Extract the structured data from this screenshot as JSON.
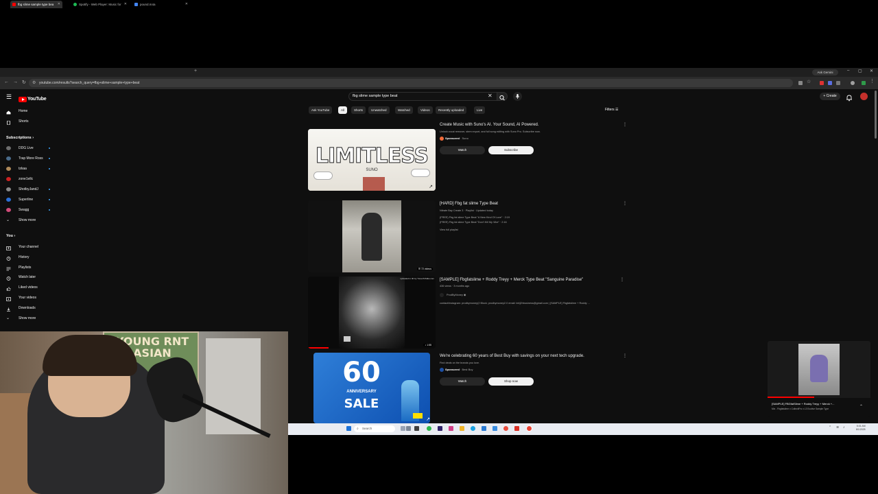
{
  "browser": {
    "tabs": [
      {
        "label": "fbg slime sample type bea",
        "color": "#ff0000"
      },
      {
        "label": "Spotify - Web Player: Music for",
        "color": "#1db954"
      },
      {
        "label": "pound.m4a",
        "color": "#4285f4"
      }
    ],
    "new_tab": "+",
    "gemini_label": "Ask Gemini",
    "url": "youtube.com/results?search_query=fbg+slime+sample+type+beat"
  },
  "youtube": {
    "logo_text": "YouTube",
    "search_value": "fbg slime sample type beat",
    "create_label": "Create",
    "filters_label": "Filters"
  },
  "sidebar": {
    "top": [
      {
        "label": "Home",
        "icon": "home-icon"
      },
      {
        "label": "Shorts",
        "icon": "shorts-icon"
      }
    ],
    "subscriptions_heading": "Subscriptions",
    "subscriptions": [
      {
        "label": "DDG Live",
        "color": "#6d6d6d"
      },
      {
        "label": "Trap More Ross",
        "color": "#4a6b8a"
      },
      {
        "label": "tzkaa",
        "color": "#b08a5a"
      },
      {
        "label": "zone1ellc",
        "color": "#cc2222"
      },
      {
        "label": "ShotbyJandJ",
        "color": "#888888"
      },
      {
        "label": "Superline",
        "color": "#2b6fd6"
      },
      {
        "label": "Swagg",
        "color": "#d14b7a"
      }
    ],
    "show_more_1": "Show more",
    "you_heading": "You",
    "you": [
      {
        "label": "Your channel",
        "icon": "channel-icon"
      },
      {
        "label": "History",
        "icon": "history-icon"
      },
      {
        "label": "Playlists",
        "icon": "playlists-icon"
      },
      {
        "label": "Watch later",
        "icon": "watch-later-icon"
      },
      {
        "label": "Liked videos",
        "icon": "liked-icon"
      },
      {
        "label": "Your videos",
        "icon": "your-videos-icon"
      },
      {
        "label": "Downloads",
        "icon": "downloads-icon"
      }
    ],
    "show_more_2": "Show more"
  },
  "chips": [
    "Ask YouTube",
    "All",
    "Shorts",
    "Unwatched",
    "Watched",
    "Videos",
    "Recently uploaded",
    "Live"
  ],
  "results": {
    "ad1": {
      "title": "Create Music with Suno's AI. Your Sound, AI Powered.",
      "desc": "Unlock vocal remover, stem export, and full song editing with Suno Pro. Subscribe now.",
      "sponsored": "Sponsored",
      "advertiser": "· Suno",
      "watch": "Watch",
      "action": "Subscribe",
      "thumb_text": "LIMITLESS",
      "thumb_sub": "SUNO"
    },
    "playlist": {
      "title": "[HARD] Fbg fat slime Type Beat",
      "meta": "Nitrate Bay Create 3 · Playlist · Updated today",
      "line1": "(FREE) Fbg fat slime Type Beat \"A New Kind Of Love\" · 2:19",
      "line2": "(FREE) Fbg fat slime Type Beat \"Don't Kill My Vibe\" · 2:16",
      "view_full": "View full playlist",
      "badge": "72 videos"
    },
    "video": {
      "title": "[SAMPLE] Fbgfatslime + Roddy Treyy + Merck Type Beat \"Sanguine Paradise\"",
      "meta": "436 views · 3 months ago",
      "channel": "ProdByMoney",
      "desc": "contact/instagram: prodbymoney(2 Block; prodbymoney2.0 email: tek]2hbusiness@gmail.com | [SAMPLE] Fbgfatslime + Roddy ...",
      "overlay": "uploaded in 4K by TunesToTalks.com",
      "duration": "1:55"
    },
    "ad2": {
      "title": "We're celebrating 60 years of Best Buy with savings on your next tech upgrade.",
      "desc": "Find deals on the brands you love.",
      "sponsored": "Sponsored",
      "advertiser": "· Best Buy",
      "watch": "Watch",
      "action": "Shop now",
      "thumb_num": "60",
      "thumb_sub": "ANNIVERSARY",
      "thumb_sale": "SALE"
    }
  },
  "miniplayer": {
    "title": "[SAMPLE] FBGfatSlime + Roddy Treyy + Merck +...",
    "subtitle": "Mix - Fbgfatslime x CollectiFrs x L3 Ecutive Sample Type"
  },
  "taskbar": {
    "search_placeholder": "Search",
    "time": "5:01 AM",
    "date": "8/1/2025"
  },
  "webcam": {
    "poster_text": "YOUNG RNT ASIAN"
  }
}
